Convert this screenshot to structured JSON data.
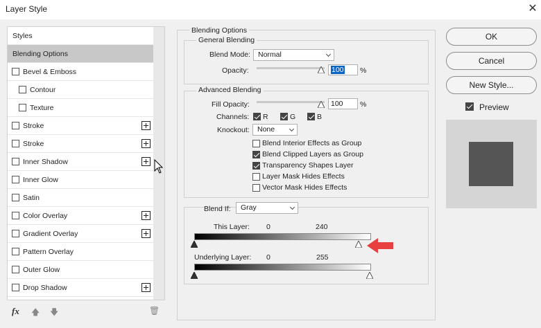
{
  "window": {
    "title": "Layer Style",
    "close": "✕"
  },
  "left_panel": {
    "items": [
      {
        "label": "Styles",
        "has_checkbox": false,
        "checked": false,
        "indent": 0,
        "selected": false,
        "has_plus": false
      },
      {
        "label": "Blending Options",
        "has_checkbox": false,
        "checked": false,
        "indent": 0,
        "selected": true,
        "has_plus": false
      },
      {
        "label": "Bevel & Emboss",
        "has_checkbox": true,
        "checked": false,
        "indent": 0,
        "selected": false,
        "has_plus": false
      },
      {
        "label": "Contour",
        "has_checkbox": true,
        "checked": false,
        "indent": 1,
        "selected": false,
        "has_plus": false
      },
      {
        "label": "Texture",
        "has_checkbox": true,
        "checked": false,
        "indent": 1,
        "selected": false,
        "has_plus": false
      },
      {
        "label": "Stroke",
        "has_checkbox": true,
        "checked": false,
        "indent": 0,
        "selected": false,
        "has_plus": true
      },
      {
        "label": "Stroke",
        "has_checkbox": true,
        "checked": false,
        "indent": 0,
        "selected": false,
        "has_plus": true
      },
      {
        "label": "Inner Shadow",
        "has_checkbox": true,
        "checked": false,
        "indent": 0,
        "selected": false,
        "has_plus": true
      },
      {
        "label": "Inner Glow",
        "has_checkbox": true,
        "checked": false,
        "indent": 0,
        "selected": false,
        "has_plus": false
      },
      {
        "label": "Satin",
        "has_checkbox": true,
        "checked": false,
        "indent": 0,
        "selected": false,
        "has_plus": false
      },
      {
        "label": "Color Overlay",
        "has_checkbox": true,
        "checked": false,
        "indent": 0,
        "selected": false,
        "has_plus": true
      },
      {
        "label": "Gradient Overlay",
        "has_checkbox": true,
        "checked": false,
        "indent": 0,
        "selected": false,
        "has_plus": true
      },
      {
        "label": "Pattern Overlay",
        "has_checkbox": true,
        "checked": false,
        "indent": 0,
        "selected": false,
        "has_plus": false
      },
      {
        "label": "Outer Glow",
        "has_checkbox": true,
        "checked": false,
        "indent": 0,
        "selected": false,
        "has_plus": false
      },
      {
        "label": "Drop Shadow",
        "has_checkbox": true,
        "checked": false,
        "indent": 0,
        "selected": false,
        "has_plus": true
      }
    ],
    "bottom_icons": [
      {
        "name": "fx-icon",
        "glyph": "fx"
      },
      {
        "name": "move-up-icon",
        "glyph": "🡅"
      },
      {
        "name": "move-down-icon",
        "glyph": "🡇"
      },
      {
        "name": "trash-icon",
        "glyph": "🗑"
      }
    ]
  },
  "blending_options": {
    "legend": "Blending Options",
    "general": {
      "legend": "General Blending",
      "blend_mode_label": "Blend Mode:",
      "blend_mode_value": "Normal",
      "opacity_label": "Opacity:",
      "opacity_value": "100",
      "percent": "%"
    },
    "advanced": {
      "legend": "Advanced Blending",
      "fill_opacity_label": "Fill Opacity:",
      "fill_opacity_value": "100",
      "percent": "%",
      "channels_label": "Channels:",
      "channels": [
        {
          "label": "R",
          "checked": true
        },
        {
          "label": "G",
          "checked": true
        },
        {
          "label": "B",
          "checked": true
        }
      ],
      "knockout_label": "Knockout:",
      "knockout_value": "None",
      "options": [
        {
          "label": "Blend Interior Effects as Group",
          "checked": false
        },
        {
          "label": "Blend Clipped Layers as Group",
          "checked": true
        },
        {
          "label": "Transparency Shapes Layer",
          "checked": true
        },
        {
          "label": "Layer Mask Hides Effects",
          "checked": false
        },
        {
          "label": "Vector Mask Hides Effects",
          "checked": false
        }
      ]
    },
    "blend_if": {
      "label": "Blend If:",
      "value": "Gray",
      "this_layer_label": "This Layer:",
      "this_layer_low": "0",
      "this_layer_high": "240",
      "underlying_label": "Underlying Layer:",
      "underlying_low": "0",
      "underlying_high": "255"
    }
  },
  "buttons": {
    "ok": "OK",
    "cancel": "Cancel",
    "new_style": "New Style..."
  },
  "preview": {
    "label": "Preview",
    "checked": true,
    "swatch_color": "#555555"
  },
  "colors": {
    "accent_highlight": "#0a64c8",
    "selected_row": "#c8c8c8",
    "annotation_arrow": "#e84040"
  }
}
